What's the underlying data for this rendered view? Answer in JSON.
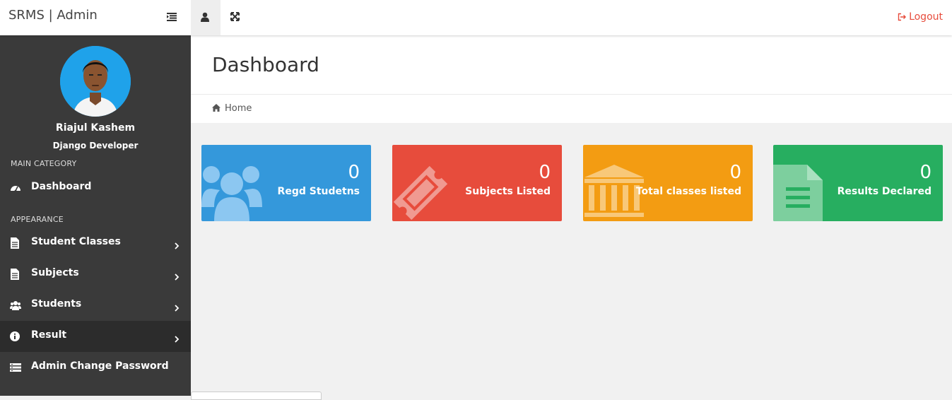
{
  "app": {
    "brand": "SRMS | Admin",
    "logout_label": "Logout"
  },
  "user": {
    "name": "Riajul Kashem",
    "role": "Django Developer"
  },
  "sidebar": {
    "main_category": "MAIN CATEGORY",
    "appearance": "APPEARANCE",
    "items": [
      {
        "label": "Dashboard",
        "icon": "dashboard-icon"
      },
      {
        "label": "Student Classes",
        "icon": "file-icon"
      },
      {
        "label": "Subjects",
        "icon": "file-icon"
      },
      {
        "label": "Students",
        "icon": "users-icon"
      },
      {
        "label": "Result",
        "icon": "info-icon"
      },
      {
        "label": "Admin Change Password",
        "icon": "server-icon"
      }
    ]
  },
  "page": {
    "title": "Dashboard",
    "breadcrumb": "Home"
  },
  "cards": [
    {
      "count": "0",
      "label": "Regd Studetns",
      "color": "#3498db",
      "icon": "users-icon"
    },
    {
      "count": "0",
      "label": "Subjects Listed",
      "color": "#e74c3c",
      "icon": "ticket-icon"
    },
    {
      "count": "0",
      "label": "Total classes listed",
      "color": "#f39c12",
      "icon": "bank-icon"
    },
    {
      "count": "0",
      "label": "Results Declared",
      "color": "#27ae60",
      "icon": "file-text-icon"
    }
  ]
}
